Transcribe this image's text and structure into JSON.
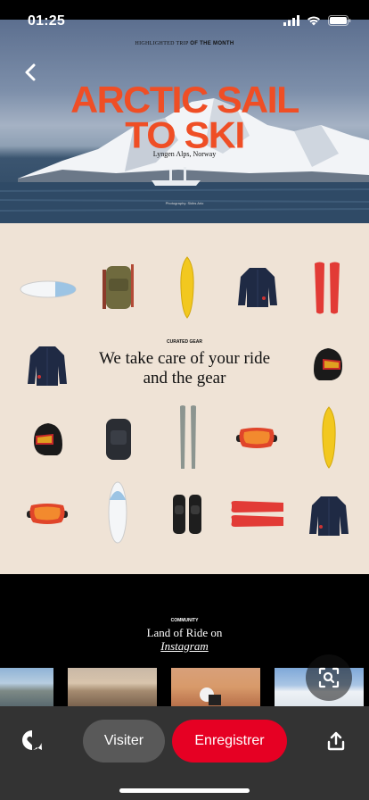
{
  "status_bar": {
    "time": "01:25"
  },
  "hero": {
    "kicker_prefix": "HIGHLIGHTED TRIP",
    "kicker_bold": "OF THE MONTH",
    "title_line1": "ARCTIC SAIL",
    "title_line2": "TO SKI",
    "subtitle": "Lyngen Alps, Norway",
    "credit": "Photography: Skibs Ario"
  },
  "gear": {
    "kicker": "CURATED GEAR",
    "heading_line1": "We take care of your ride",
    "heading_line2": "and the gear",
    "items": [
      "surfboard",
      "backpack",
      "yellow-snowboard",
      "jacket",
      "red-split-skis",
      "jacket",
      "helmet",
      "helmet",
      "black-backpack",
      "grey-skis",
      "goggles",
      "yellow-snowboard",
      "goggles",
      "surfboard",
      "knee-pads",
      "red-split-board",
      "jacket"
    ]
  },
  "community": {
    "kicker": "COMMUNITY",
    "title": "Land of Ride on",
    "link": "Instagram"
  },
  "actions": {
    "visit_label": "Visiter",
    "save_label": "Enregistrer"
  },
  "colors": {
    "accent_orange": "#ef4e25",
    "save_red": "#e60023",
    "gear_background": "#efe3d6",
    "bottom_bar": "#333333"
  }
}
